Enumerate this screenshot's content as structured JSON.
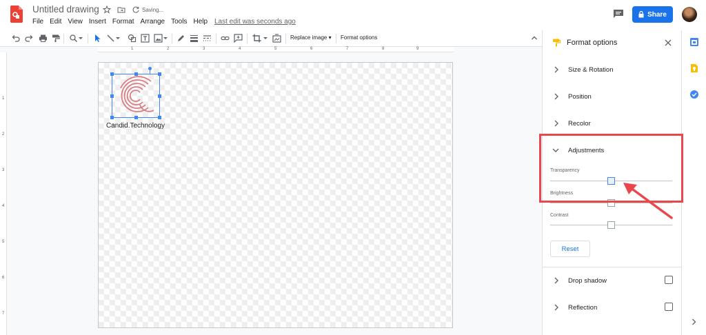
{
  "header": {
    "title": "Untitled drawing",
    "saving": "Saving...",
    "menu": [
      "File",
      "Edit",
      "View",
      "Insert",
      "Format",
      "Arrange",
      "Tools",
      "Help"
    ],
    "last_edit": "Last edit was seconds ago",
    "share_label": "Share"
  },
  "toolbar": {
    "replace_image": "Replace image ▾",
    "format_options": "Format options"
  },
  "rulers": {
    "h": [
      "1",
      "2",
      "3",
      "4",
      "5",
      "6",
      "7",
      "8",
      "9"
    ],
    "v": [
      "1",
      "2",
      "3",
      "4",
      "5",
      "6",
      "7"
    ]
  },
  "canvas": {
    "caption": "Candid.Technology"
  },
  "panel": {
    "title": "Format options",
    "sections": {
      "size_rotation": "Size & Rotation",
      "position": "Position",
      "recolor": "Recolor",
      "adjustments": "Adjustments",
      "drop_shadow": "Drop shadow",
      "reflection": "Reflection"
    },
    "transparency": "Transparency",
    "brightness": "Brightness",
    "contrast": "Contrast",
    "reset": "Reset",
    "slider_levels": {
      "transparency": 0.5,
      "brightness": 0.5,
      "contrast": 0.5
    }
  },
  "colors": {
    "accent": "#1a73e8",
    "annotation": "#e9474d",
    "logo": "#d97d83"
  }
}
